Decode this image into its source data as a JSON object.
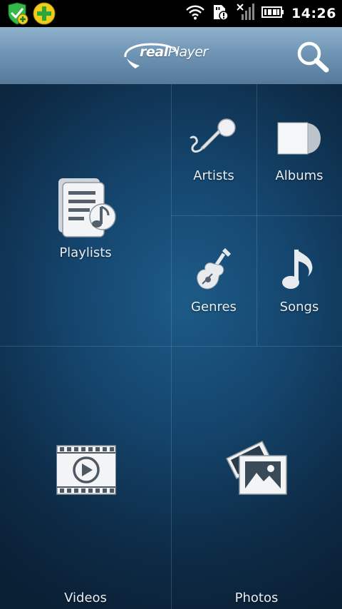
{
  "status_bar": {
    "time": "14:26",
    "icons": [
      "shield-plus-icon",
      "green-plus-icon",
      "wifi-icon",
      "sd-card-alert-icon",
      "no-signal-icon",
      "battery-full-icon"
    ]
  },
  "header": {
    "logo_prefix": "real",
    "logo_suffix": "Player",
    "search_icon": "magnifier-icon"
  },
  "menu": {
    "playlists": {
      "label": "Playlists",
      "icon": "playlist-document-icon"
    },
    "artists": {
      "label": "Artists",
      "icon": "microphone-icon"
    },
    "albums": {
      "label": "Albums",
      "icon": "album-icon"
    },
    "genres": {
      "label": "Genres",
      "icon": "guitar-icon"
    },
    "songs": {
      "label": "Songs",
      "icon": "music-note-icon"
    },
    "videos": {
      "label": "Videos",
      "icon": "film-play-icon"
    },
    "photos": {
      "label": "Photos",
      "icon": "photos-icon"
    }
  },
  "colors": {
    "header_top": "#8fb1cc",
    "header_bottom": "#56799a",
    "background_center": "#1c5b86",
    "background_edge": "#0a2035",
    "icon_fill": "#e0e4e8"
  }
}
